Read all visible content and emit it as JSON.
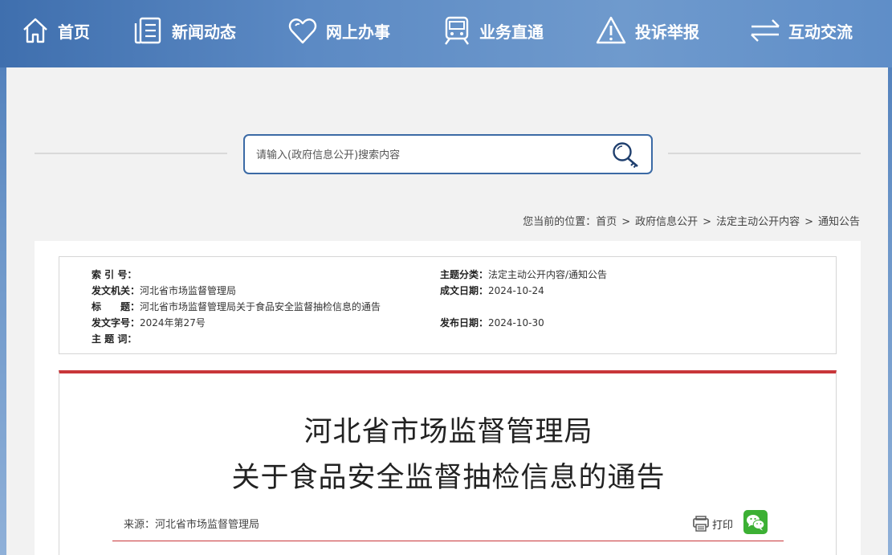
{
  "nav": {
    "items": [
      {
        "label": "首页",
        "icon": "home-icon"
      },
      {
        "label": "新闻动态",
        "icon": "news-icon"
      },
      {
        "label": "网上办事",
        "icon": "heart-icon"
      },
      {
        "label": "业务直通",
        "icon": "train-icon"
      },
      {
        "label": "投诉举报",
        "icon": "warning-icon"
      },
      {
        "label": "互动交流",
        "icon": "exchange-icon"
      }
    ]
  },
  "search": {
    "placeholder": "请输入(政府信息公开)搜索内容",
    "icon": "search-key-icon"
  },
  "breadcrumb": {
    "prefix": "您当前的位置：",
    "items": [
      "首页",
      "政府信息公开",
      "法定主动公开内容",
      "通知公告"
    ],
    "separator": ">"
  },
  "meta": {
    "index_label": "索 引 号：",
    "index_value": "",
    "category_label": "主题分类：",
    "category_value": "法定主动公开内容/通知公告",
    "issuer_label": "发文机关：",
    "issuer_value": "河北省市场监督管理局",
    "date_written_label": "成文日期：",
    "date_written_value": "2024-10-24",
    "title_label": "标　　题：",
    "title_value": "河北省市场监督管理局关于食品安全监督抽检信息的通告",
    "doc_no_label": "发文字号：",
    "doc_no_value": "2024年第27号",
    "publish_date_label": "发布日期：",
    "publish_date_value": "2024-10-30",
    "keywords_label": "主 题 词：",
    "keywords_value": ""
  },
  "doc": {
    "title_line1": "河北省市场监督管理局",
    "title_line2": "关于食品安全监督抽检信息的通告",
    "source": "来源：河北省市场监督管理局",
    "print_label": "打印",
    "share_icon": "wechat-icon"
  },
  "colors": {
    "accent_red": "#c8363a",
    "nav_blue": "#4a7ab8",
    "search_border": "#3b6aa5",
    "wechat_green": "#3cb034"
  }
}
